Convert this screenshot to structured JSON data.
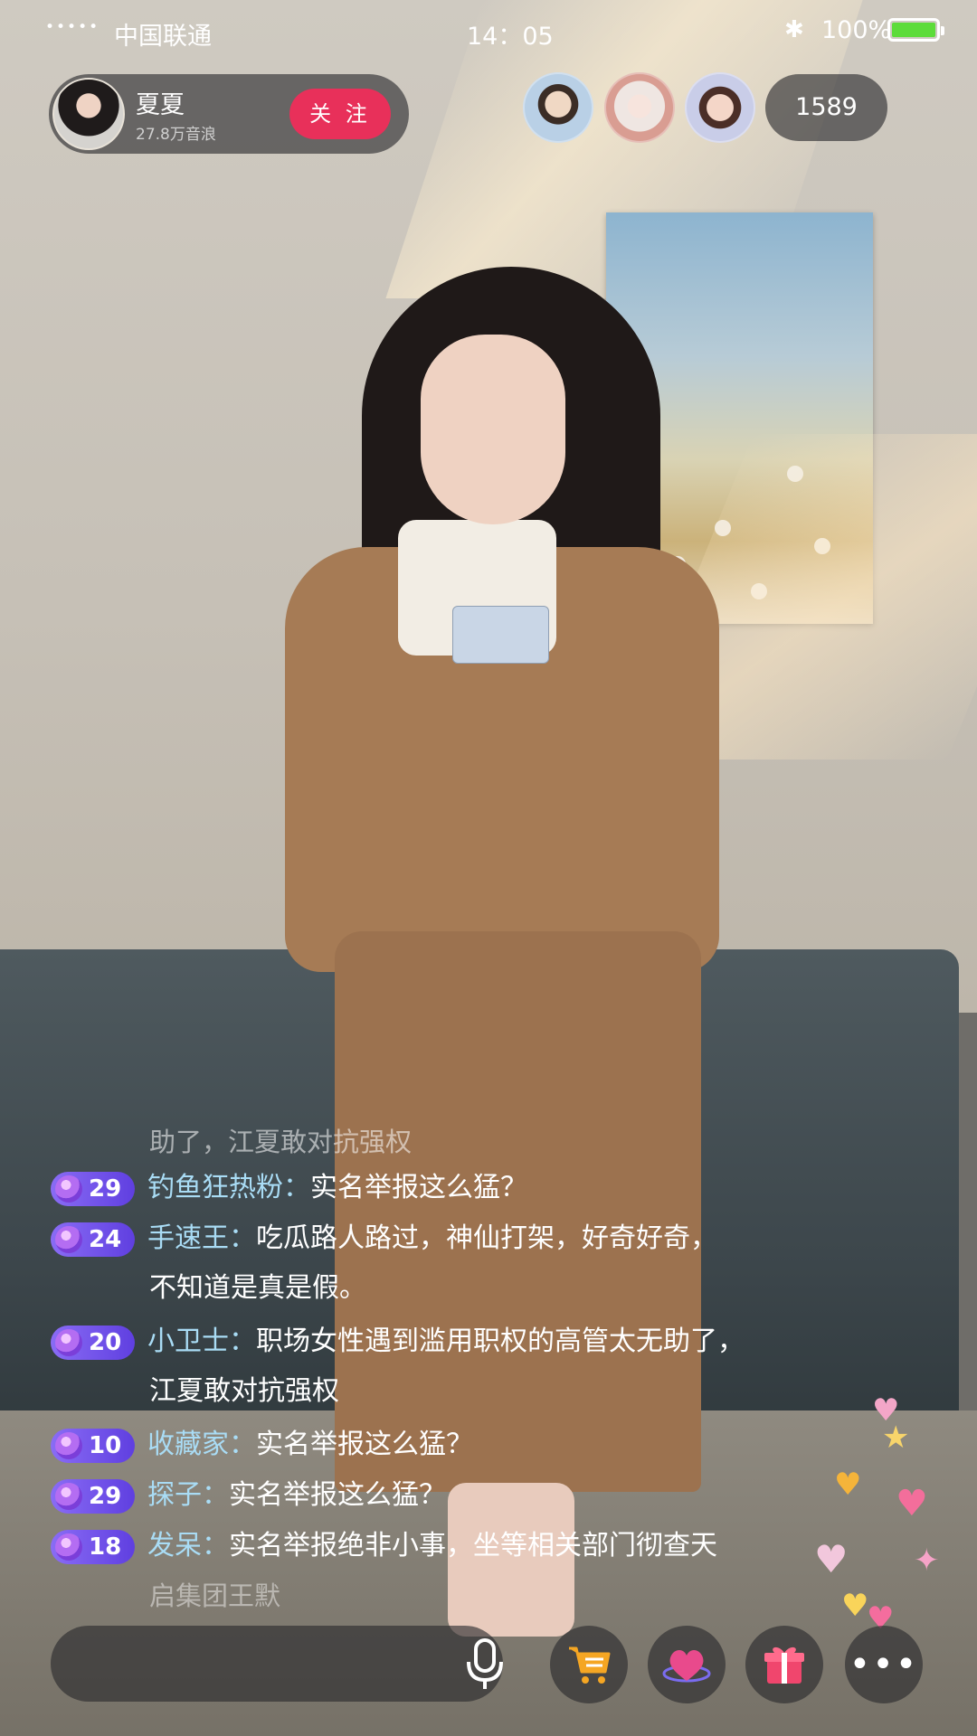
{
  "status_bar": {
    "signal": "•••••",
    "carrier": "中国联通",
    "time": "14：05",
    "bluetooth": "✱",
    "battery_percent": "100%",
    "battery_level": 1.0,
    "battery_color": "#5ddc3a"
  },
  "host": {
    "name": "夏夏",
    "followers": "27.8万音浪",
    "follow_label": "关 注",
    "follow_color": "#e8305a"
  },
  "viewers": {
    "count": "1589"
  },
  "comments": {
    "faded_line": "助了，江夏敢对抗强权",
    "items": [
      {
        "level": "29",
        "name": "钓鱼狂热粉：",
        "text": "实名举报这么猛？",
        "cont": ""
      },
      {
        "level": "24",
        "name": "手速王：",
        "text": "吃瓜路人路过，神仙打架，好奇好奇，",
        "cont": "不知道是真是假。"
      },
      {
        "level": "20",
        "name": "小卫士：",
        "text": "职场女性遇到滥用职权的高管太无助了，",
        "cont": "江夏敢对抗强权"
      },
      {
        "level": "10",
        "name": "收藏家：",
        "text": "实名举报这么猛？",
        "cont": ""
      },
      {
        "level": "29",
        "name": "探子：",
        "text": "实名举报这么猛？",
        "cont": ""
      },
      {
        "level": "18",
        "name": "发呆：",
        "text": "实名举报绝非小事，坐等相关部门彻查天",
        "cont": ""
      }
    ],
    "tail_line": "启集团王默",
    "name_color": "#a9dcf5",
    "badge_color": "#7a5cf0"
  },
  "icons": {
    "mic": "mic-icon",
    "cart": "cart-icon",
    "heart": "heart-icon",
    "gift": "gift-icon",
    "more": "more-icon",
    "more_glyph": "•••"
  }
}
